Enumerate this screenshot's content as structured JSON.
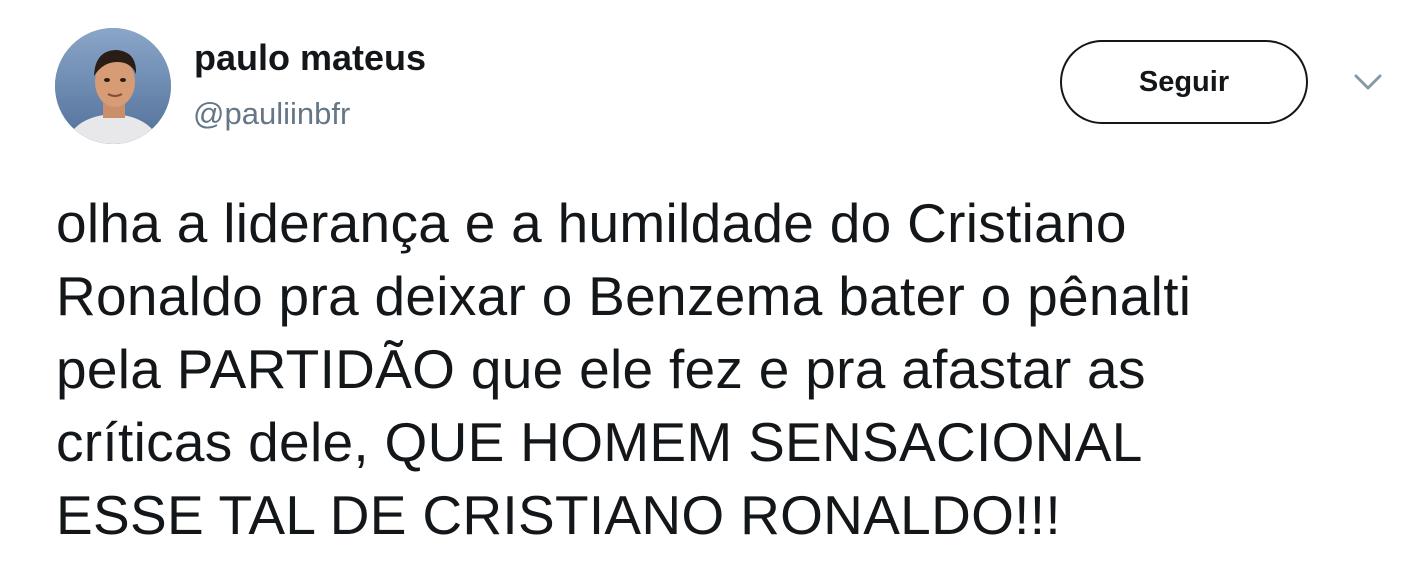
{
  "author": {
    "display_name": "paulo mateus",
    "handle": "@pauliinbfr",
    "avatar_icon": "profile-photo-avatar"
  },
  "actions": {
    "follow_label": "Seguir",
    "menu_icon": "chevron-down-icon"
  },
  "tweet": {
    "lines": [
      "olha a liderança e a humildade do Cristiano",
      "Ronaldo pra deixar o Benzema bater o pênalti",
      "pela PARTIDÃO que ele fez e pra afastar as",
      "críticas dele, QUE HOMEM SENSACIONAL",
      "ESSE TAL DE CRISTIANO RONALDO!!!"
    ]
  },
  "colors": {
    "text_primary": "#14171a",
    "text_secondary": "#657786",
    "background": "#ffffff"
  }
}
